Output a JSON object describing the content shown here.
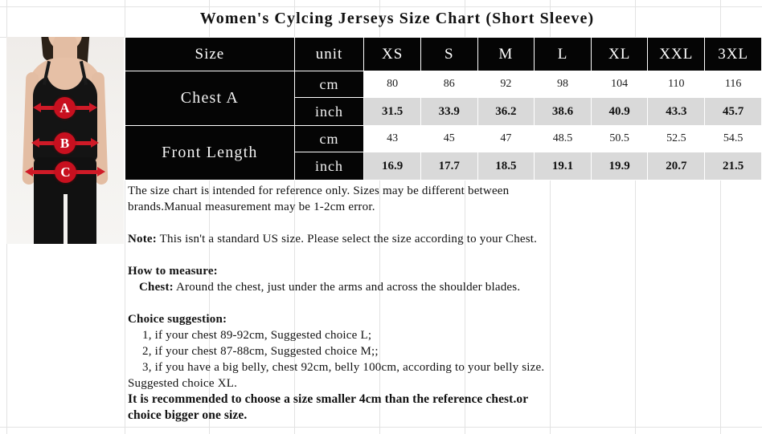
{
  "title": "Women's Cylcing Jerseys Size Chart (Short Sleeve)",
  "photo": {
    "alt": "woman-measurement-diagram",
    "markers": [
      {
        "letter": "A",
        "meaning": "chest"
      },
      {
        "letter": "B",
        "meaning": "waist"
      },
      {
        "letter": "C",
        "meaning": "hip"
      }
    ],
    "marker_color": "#c8101f"
  },
  "table": {
    "header": {
      "size_label": "Size",
      "unit_label": "unit",
      "sizes": [
        "XS",
        "S",
        "M",
        "L",
        "XL",
        "XXL",
        "3XL"
      ]
    },
    "rows": [
      {
        "label": "Chest A",
        "cm_unit": "cm",
        "inch_unit": "inch",
        "cm": [
          "80",
          "86",
          "92",
          "98",
          "104",
          "110",
          "116"
        ],
        "inch": [
          "31.5",
          "33.9",
          "36.2",
          "38.6",
          "40.9",
          "43.3",
          "45.7"
        ]
      },
      {
        "label": "Front Length",
        "cm_unit": "cm",
        "inch_unit": "inch",
        "cm": [
          "43",
          "45",
          "47",
          "48.5",
          "50.5",
          "52.5",
          "54.5"
        ],
        "inch": [
          "16.9",
          "17.7",
          "18.5",
          "19.1",
          "19.9",
          "20.7",
          "21.5"
        ]
      }
    ],
    "header_bg": "#050505",
    "inch_row_bg": "#d9d9d9"
  },
  "notes": {
    "disclaimer_line1": "The size chart is intended for reference only. Sizes may be different between",
    "disclaimer_line2": "brands.Manual measurement may be 1-2cm error.",
    "note_label": "Note:",
    "note_text": "This isn't a standard US size. Please select the size according to your Chest.",
    "how_to_measure_heading": "How to measure:",
    "chest_label": "Chest:",
    "chest_text": "Around the chest, just under the arms and across the shoulder blades.",
    "choice_heading": "Choice suggestion:",
    "choice_items": [
      "1, if your chest 89-92cm, Suggested choice L;",
      "2, if your chest 87-88cm, Suggested choice M;;",
      "3, if you have a big belly, chest 92cm, belly 100cm, according to your belly size.",
      "Suggested choice XL."
    ],
    "recommend_line1": "It is recommended to choose a size smaller 4cm than the reference chest.or",
    "recommend_line2": "choice bigger one size."
  }
}
